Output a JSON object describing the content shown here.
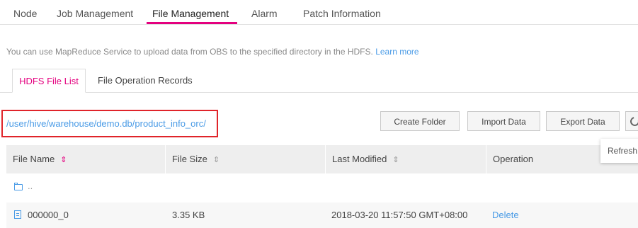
{
  "nav": {
    "tabs": [
      "Node",
      "Job Management",
      "File Management",
      "Alarm",
      "Patch Information"
    ],
    "active": "File Management"
  },
  "info": {
    "text": "You can use MapReduce Service to upload data from OBS to the specified directory in the HDFS.",
    "link": "Learn more"
  },
  "sub_tabs": [
    "HDFS File List",
    "File Operation Records"
  ],
  "path": "/user/hive/warehouse/demo.db/product_info_orc/",
  "toolbar": {
    "create_folder": "Create Folder",
    "import_data": "Import Data",
    "export_data": "Export Data"
  },
  "tooltip": "Refresh",
  "table": {
    "columns": [
      "File Name",
      "File Size",
      "Last Modified",
      "Operation"
    ],
    "sort_glyph": "⇕",
    "parent_row": {
      "name": ".."
    },
    "rows": [
      {
        "name": "000000_0",
        "size": "3.35 KB",
        "modified": "2018-03-20 11:57:50 GMT+08:00",
        "operation": "Delete"
      }
    ]
  },
  "colors": {
    "accent": "#e4007f",
    "link": "#4a9be6",
    "highlight_border": "#e0242a"
  },
  "icons": {
    "refresh": "refresh-icon",
    "folder": "folder-icon",
    "file": "file-icon"
  }
}
